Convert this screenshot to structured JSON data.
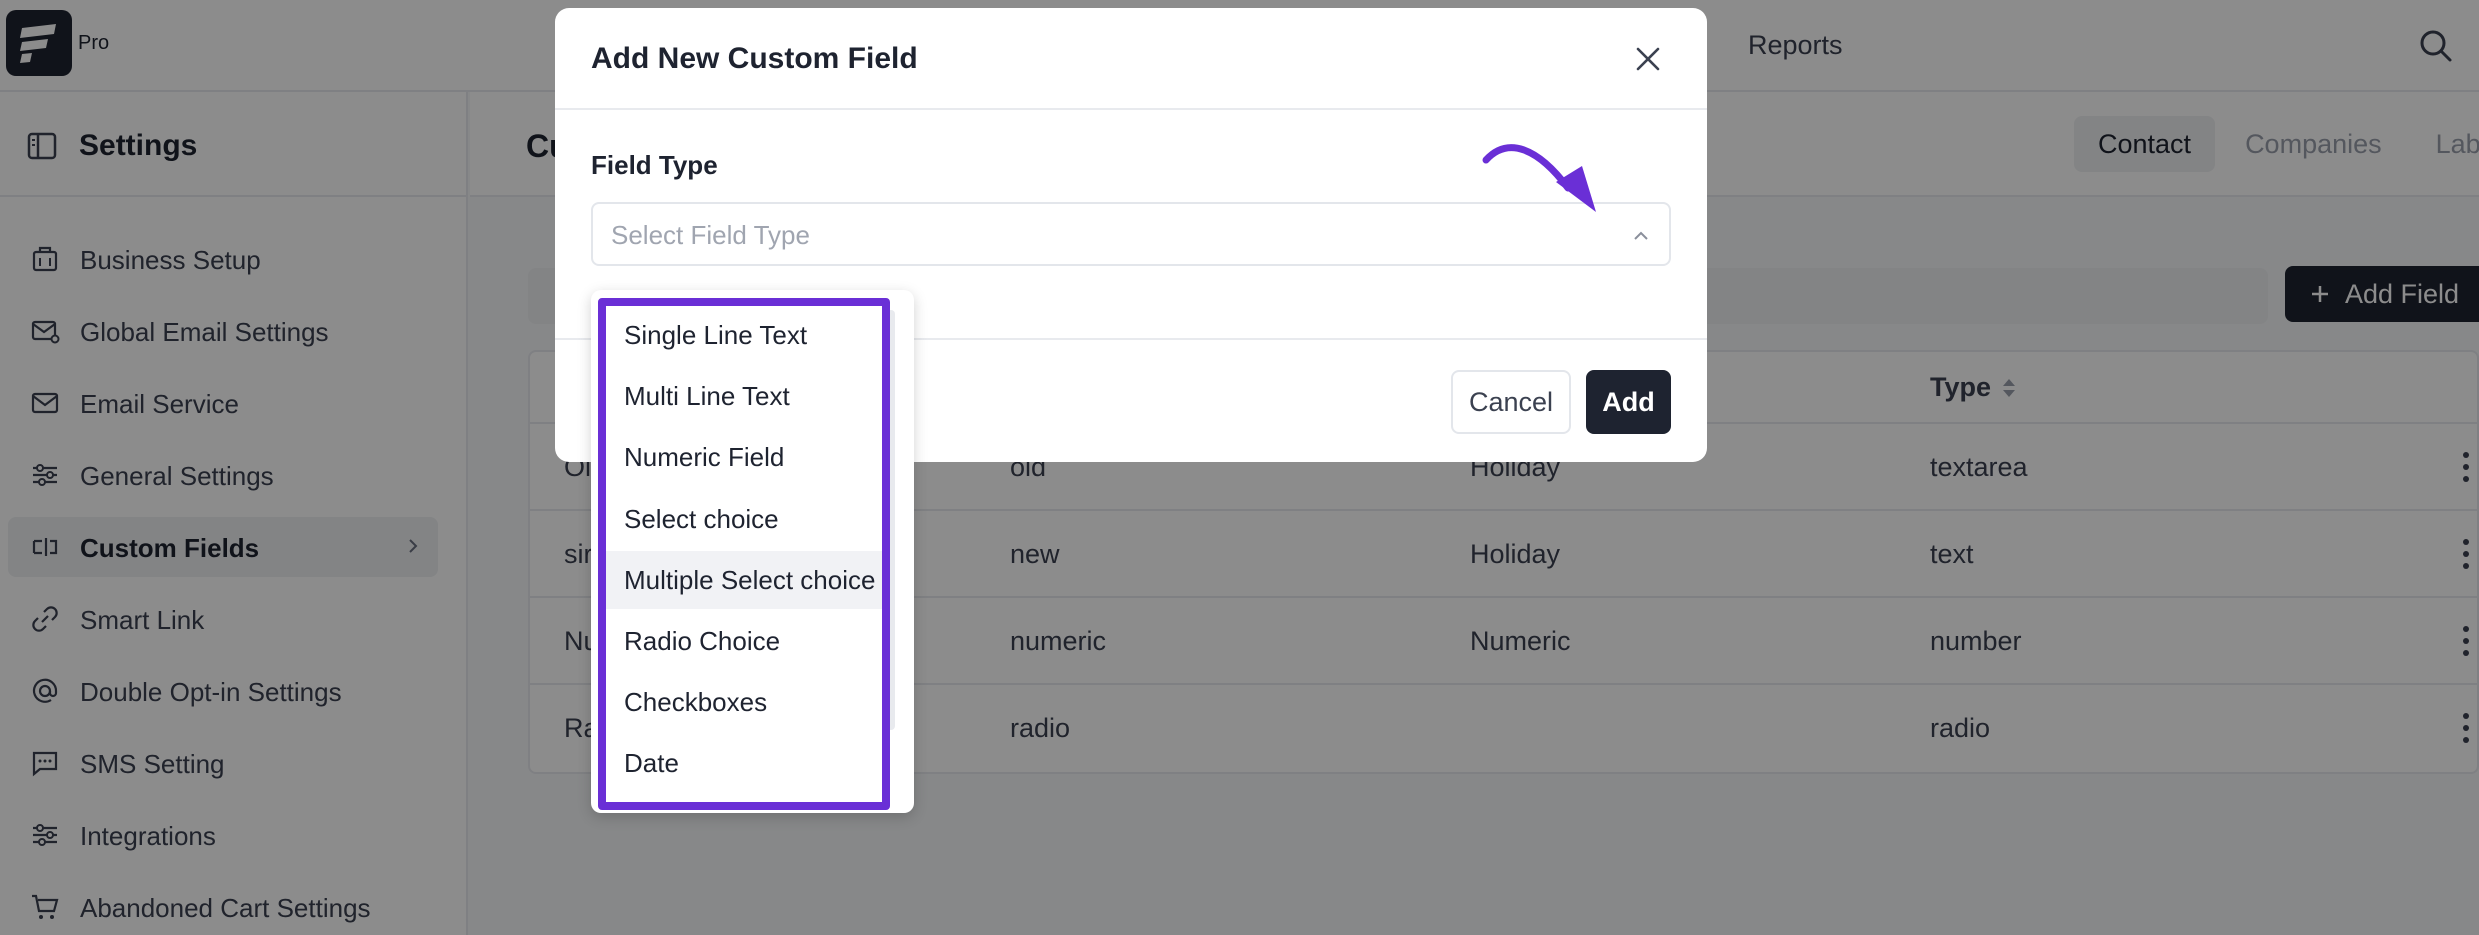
{
  "app": {
    "logo_badge": "Pro",
    "nav": {
      "reports": "Reports"
    }
  },
  "sidebar": {
    "title": "Settings",
    "items": [
      {
        "label": "Business Setup",
        "icon": "building-icon"
      },
      {
        "label": "Global Email Settings",
        "icon": "mail-settings-icon"
      },
      {
        "label": "Email Service",
        "icon": "mail-icon"
      },
      {
        "label": "General Settings",
        "icon": "sliders-icon"
      },
      {
        "label": "Custom Fields",
        "icon": "custom-fields-icon",
        "active": true
      },
      {
        "label": "Smart Link",
        "icon": "link-icon"
      },
      {
        "label": "Double Opt-in Settings",
        "icon": "at-icon"
      },
      {
        "label": "SMS Setting",
        "icon": "sms-icon"
      },
      {
        "label": "Integrations",
        "icon": "sliders-icon"
      },
      {
        "label": "Abandoned Cart Settings",
        "icon": "cart-icon"
      }
    ]
  },
  "main": {
    "title": "Cu",
    "tabs": [
      "Contact",
      "Companies",
      "Labe"
    ],
    "add_field_label": "Add Field",
    "table": {
      "type_header": "Type",
      "rows": [
        {
          "c1": "Ol",
          "c2": "old",
          "c3": "Holiday",
          "c4": "textarea"
        },
        {
          "c1": "sir",
          "c2": "new",
          "c3": "Holiday",
          "c4": "text"
        },
        {
          "c1": "Nu",
          "c2": "numeric",
          "c3": "Numeric",
          "c4": "number"
        },
        {
          "c1": "Ra",
          "c2": "radio",
          "c3": "",
          "c4": "radio"
        }
      ]
    }
  },
  "modal": {
    "title": "Add New Custom Field",
    "field_type_label": "Field Type",
    "select_placeholder": "Select Field Type",
    "cancel_label": "Cancel",
    "add_label": "Add",
    "options": [
      "Single Line Text",
      "Multi Line Text",
      "Numeric Field",
      "Select choice",
      "Multiple Select choice",
      "Radio Choice",
      "Checkboxes",
      "Date"
    ],
    "hovered_option_index": 4
  },
  "colors": {
    "accent_dark": "#1e2330",
    "annotation_purple": "#6a2fd6",
    "overlay": "rgba(0,0,0,0.45)"
  }
}
